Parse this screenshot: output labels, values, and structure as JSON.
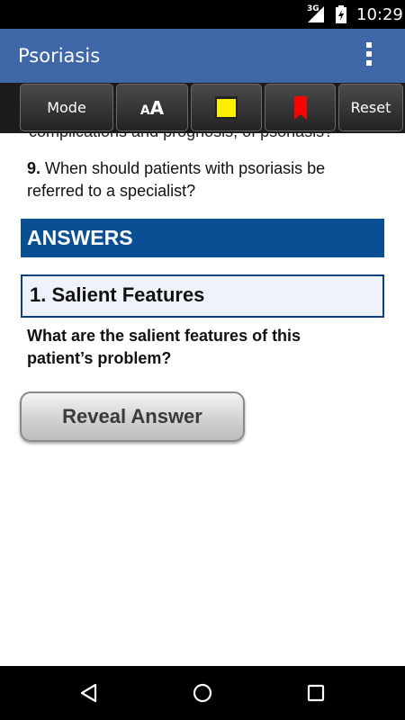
{
  "status_bar": {
    "network": "3G",
    "time": "10:29"
  },
  "app_bar": {
    "title": "Psoriasis"
  },
  "toolbar": {
    "mode_label": "Mode",
    "font_label_small": "A",
    "font_label_big": "A",
    "reset_label": "Reset"
  },
  "content": {
    "cut_text": "complications and prognosis, of psoriasis?",
    "question_9_number": "9.",
    "question_9_text": " When should patients with psoriasis be referred to a specialist?",
    "answers_heading": "ANSWERS",
    "feature_title": "1. Salient Features",
    "feature_question": "What are the salient features of this patient’s problem?",
    "reveal_button_label": "Reveal Answer"
  },
  "colors": {
    "app_bar": "#3f67a8",
    "answers_header": "#0a4f94",
    "note_icon": "#ffee00",
    "bookmark_icon": "#ff0000"
  }
}
